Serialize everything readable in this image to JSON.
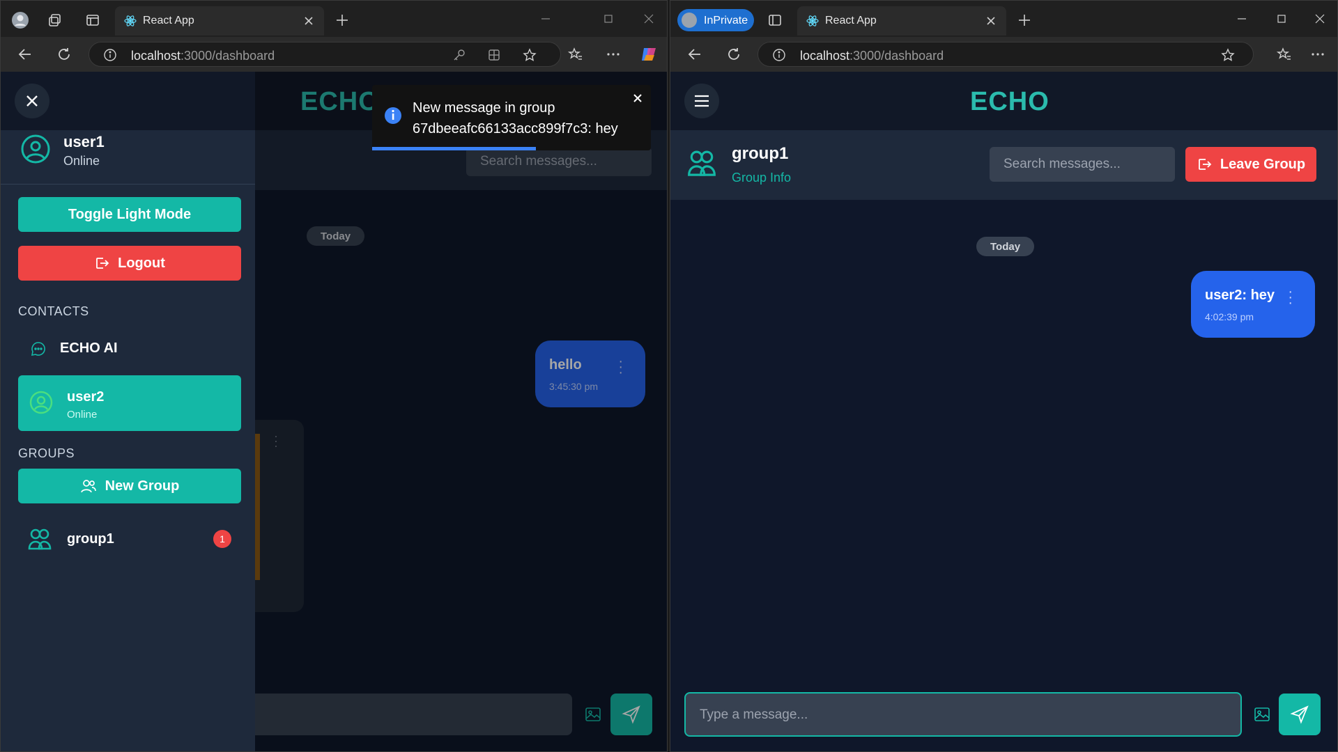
{
  "left_browser": {
    "tab_title": "React App",
    "url_host": "localhost",
    "url_path": ":3000/dashboard",
    "app": {
      "logo": "ECHO",
      "search_placeholder": "Search messages...",
      "date_pill": "Today",
      "message": {
        "text": "hello",
        "time": "3:45:30 pm"
      },
      "toast": {
        "line1": "New message in group",
        "line2": "67dbeeafc66133acc899f7c3: hey"
      },
      "sidebar": {
        "username": "user1",
        "status": "Online",
        "toggle_label": "Toggle Light Mode",
        "logout_label": "Logout",
        "contacts_header": "CONTACTS",
        "contacts": [
          {
            "name": "ECHO AI"
          },
          {
            "name": "user2",
            "status": "Online"
          }
        ],
        "groups_header": "GROUPS",
        "new_group_label": "New Group",
        "groups": [
          {
            "name": "group1",
            "unread": "1"
          }
        ]
      }
    }
  },
  "right_browser": {
    "inprivate_label": "InPrivate",
    "tab_title": "React App",
    "url_host": "localhost",
    "url_path": ":3000/dashboard",
    "app": {
      "logo": "ECHO",
      "group_name": "group1",
      "group_info_link": "Group Info",
      "search_placeholder": "Search messages...",
      "leave_label": "Leave Group",
      "date_pill": "Today",
      "message": {
        "text": "user2: hey",
        "time": "4:02:39 pm"
      },
      "input_placeholder": "Type a message..."
    }
  },
  "colors": {
    "accent": "#14b8a6",
    "danger": "#ef4444",
    "bubble": "#2563eb",
    "bg": "#0f172a"
  }
}
